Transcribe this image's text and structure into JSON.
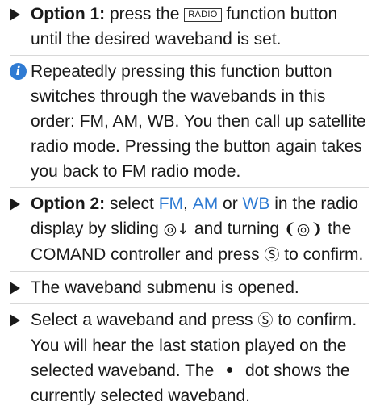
{
  "option1": {
    "label": "Option 1:",
    "text_before": " press the ",
    "key": "RADIO",
    "text_after": " function button until the desired waveband is set."
  },
  "info": {
    "icon": "info-icon",
    "text": "Repeatedly pressing this function button switches through the wavebands in this order: FM, AM, WB. You then call up satellite radio mode. Pressing the button again takes you back to FM radio mode."
  },
  "option2": {
    "label": "Option 2:",
    "text_select": " select ",
    "fm": "FM",
    "comma": ", ",
    "am": "AM",
    "or": " or ",
    "wb": "WB",
    "text_mid": " in the radio display by sliding ",
    "slide_symbol": "◎↓",
    "text_turning": " and turning ",
    "turn_symbol": "❨◎❩",
    "text_controller": " the COMAND controller and press ",
    "press_symbol": "Ⓢ",
    "text_end": " to confirm."
  },
  "step_submenu": {
    "text": "The waveband submenu is opened."
  },
  "step_select": {
    "text_before": "Select a waveband and press ",
    "press_symbol": "Ⓢ",
    "text_after": " to confirm. You will hear the last station played on the selected waveband. The ",
    "text_dot_after": " dot shows the currently selected waveband."
  },
  "colors": {
    "accent": "#2f7bd3",
    "text": "#1a1a1a"
  }
}
